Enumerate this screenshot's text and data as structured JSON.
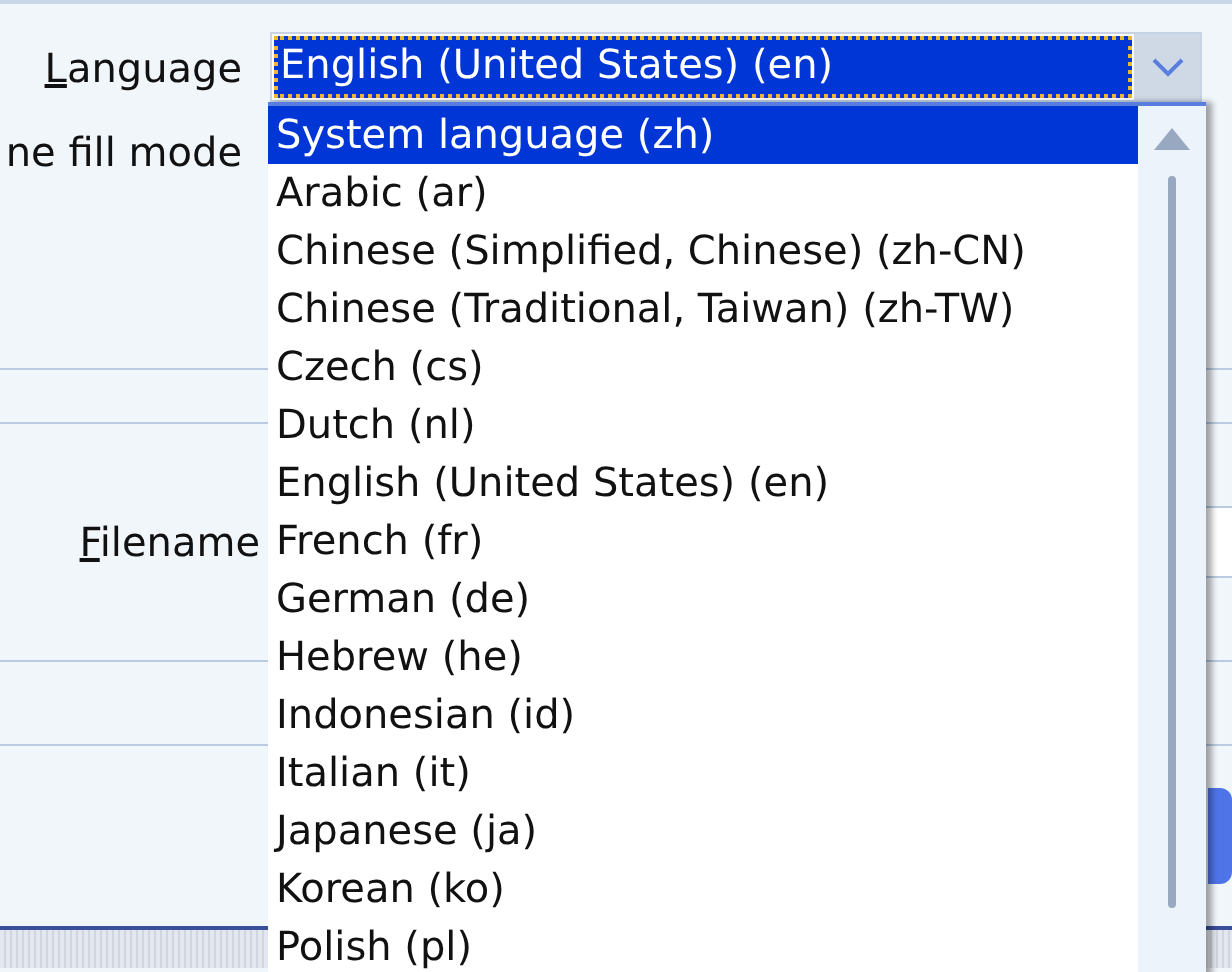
{
  "form": {
    "labels": [
      {
        "text": "Language",
        "underline_first": true
      },
      {
        "text": "ne fill mode",
        "underline_first": false
      },
      {
        "text": "Filename",
        "underline_first": true
      }
    ]
  },
  "language_combo": {
    "value": "English (United States) (en)",
    "focused": true
  },
  "language_list": {
    "items": [
      {
        "label": "System language (zh)",
        "selected": true
      },
      {
        "label": "Arabic (ar)",
        "selected": false
      },
      {
        "label": "Chinese (Simplified, Chinese) (zh-CN)",
        "selected": false
      },
      {
        "label": "Chinese (Traditional, Taiwan) (zh-TW)",
        "selected": false
      },
      {
        "label": "Czech (cs)",
        "selected": false
      },
      {
        "label": "Dutch (nl)",
        "selected": false
      },
      {
        "label": "English (United States) (en)",
        "selected": false
      },
      {
        "label": "French (fr)",
        "selected": false
      },
      {
        "label": "German (de)",
        "selected": false
      },
      {
        "label": "Hebrew (he)",
        "selected": false
      },
      {
        "label": "Indonesian (id)",
        "selected": false
      },
      {
        "label": "Italian (it)",
        "selected": false
      },
      {
        "label": "Japanese (ja)",
        "selected": false
      },
      {
        "label": "Korean (ko)",
        "selected": false
      },
      {
        "label": "Polish (pl)",
        "selected": false
      }
    ]
  }
}
